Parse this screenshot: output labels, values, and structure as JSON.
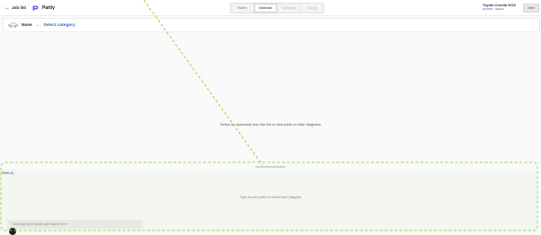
{
  "header": {
    "back_label": "Job list",
    "brand_name": "Partly",
    "steps": [
      {
        "label": "Home",
        "state": "normal"
      },
      {
        "label": "Estimate",
        "state": "active"
      },
      {
        "label": "Summary",
        "state": "disabled"
      },
      {
        "label": "Supply",
        "state": "disabled"
      }
    ],
    "vehicle_name": "Toyota Corolla 2023",
    "vehicle_sub": "R1A0350 · SEDAN",
    "next_label": "Next"
  },
  "breadcrumb": {
    "root": "Nose",
    "separator": ">",
    "current": "Select category"
  },
  "main": {
    "message": "Select an assembly from the list to view parts on their diagrams"
  },
  "parts": {
    "title": "Parts (0)",
    "empty_message": "Type to add parts or select from diagram",
    "input_placeholder": "Start typing or paste part name here"
  },
  "colors": {
    "accent": "#3a61d8",
    "brand": "#6b5cf0",
    "dashed_overlay": "#8bd53b",
    "parts_panel_bg": "#f3f6f1"
  },
  "icons": {
    "back": "arrow-left-icon",
    "brand": "partly-logo-icon",
    "vehicle": "car-outline-icon",
    "fab": "dark-circle-button-icon"
  }
}
